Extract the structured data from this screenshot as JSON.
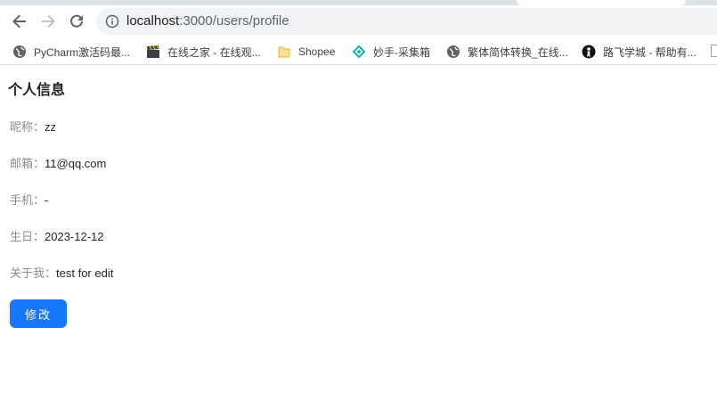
{
  "browser": {
    "url_host": "localhost",
    "url_rest": ":3000/users/profile",
    "bookmarks": [
      {
        "label": "PyCharm激活码最...",
        "icon": "globe-icon"
      },
      {
        "label": "在线之家 - 在线观...",
        "icon": "clapperboard-icon"
      },
      {
        "label": "Shopee",
        "icon": "folder-icon"
      },
      {
        "label": "妙手-采集箱",
        "icon": "diamond-logo-icon"
      },
      {
        "label": "繁体简体转换_在线...",
        "icon": "globe-icon"
      },
      {
        "label": "路飞学城 - 帮助有...",
        "icon": "person-logo-icon"
      }
    ]
  },
  "profile": {
    "title": "个人信息",
    "fields": [
      {
        "label": "昵称：",
        "value": "zz"
      },
      {
        "label": "邮箱：",
        "value": "11@qq.com"
      },
      {
        "label": "手机：",
        "value": "-"
      },
      {
        "label": "生日：",
        "value": "2023-12-12"
      },
      {
        "label": "关于我：",
        "value": "test for edit"
      }
    ],
    "edit_label": "修改"
  },
  "colors": {
    "primary": "#1677ff",
    "label": "#8c8c8c",
    "value": "#262626"
  }
}
